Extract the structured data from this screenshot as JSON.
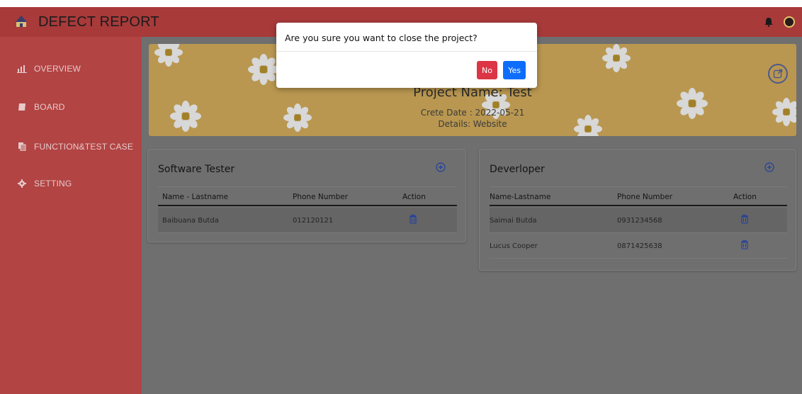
{
  "app": {
    "title": "DEFECT REPORT"
  },
  "sidebar": {
    "items": [
      {
        "label": "OVERVIEW",
        "icon": "chart-icon"
      },
      {
        "label": "BOARD",
        "icon": "book-icon"
      },
      {
        "label": "FUNCTION&TEST CASE",
        "icon": "documents-icon"
      },
      {
        "label": "SETTING",
        "icon": "gear-icon"
      }
    ]
  },
  "banner": {
    "title": "Project Name: Test",
    "date_label": "Crete Date : 2022-05-21",
    "details_label": "Details: Website"
  },
  "tester": {
    "title": "Software Tester",
    "columns": [
      "Name - Lastname",
      "Phone Number",
      "Action"
    ],
    "rows": [
      {
        "name": "Baibuana  Butda",
        "phone": "012120121"
      }
    ]
  },
  "developer": {
    "title": "Deverloper",
    "columns": [
      "Name-Lastname",
      "Phone Number",
      "Action"
    ],
    "rows": [
      {
        "name": "Saimai  Butda",
        "phone": "0931234568"
      },
      {
        "name": "Lucus  Cooper",
        "phone": "0871425638"
      }
    ]
  },
  "dialog": {
    "message": "Are you sure you want to close the project?",
    "no_label": "No",
    "yes_label": "Yes"
  },
  "colors": {
    "topbar": "#a83a3a",
    "sidebar": "#b24444",
    "no_button": "#dc3545",
    "yes_button": "#0d6efd"
  }
}
